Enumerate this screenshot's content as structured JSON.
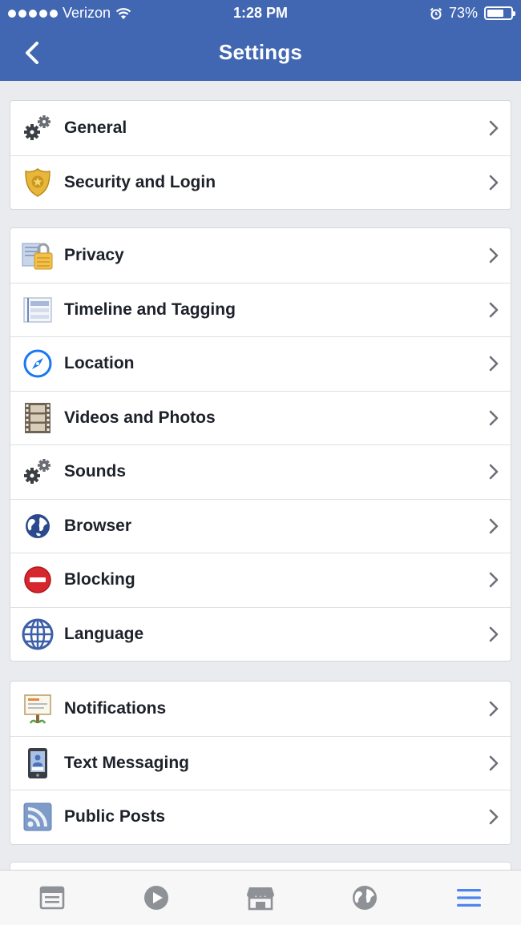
{
  "status_bar": {
    "carrier": "Verizon",
    "time": "1:28 PM",
    "battery": "73%",
    "battery_level": 0.73
  },
  "header": {
    "title": "Settings",
    "back_icon": "chevron-left-icon"
  },
  "groups": [
    {
      "items": [
        {
          "label": "General",
          "icon": "gears-icon"
        },
        {
          "label": "Security and Login",
          "icon": "shield-badge-icon"
        }
      ]
    },
    {
      "items": [
        {
          "label": "Privacy",
          "icon": "privacy-lock-icon"
        },
        {
          "label": "Timeline and Tagging",
          "icon": "timeline-icon"
        },
        {
          "label": "Location",
          "icon": "compass-icon"
        },
        {
          "label": "Videos and Photos",
          "icon": "film-strip-icon"
        },
        {
          "label": "Sounds",
          "icon": "gears-icon"
        },
        {
          "label": "Browser",
          "icon": "globe-icon"
        },
        {
          "label": "Blocking",
          "icon": "block-icon"
        },
        {
          "label": "Language",
          "icon": "world-grid-icon"
        }
      ]
    },
    {
      "items": [
        {
          "label": "Notifications",
          "icon": "notification-sign-icon"
        },
        {
          "label": "Text Messaging",
          "icon": "phone-icon"
        },
        {
          "label": "Public Posts",
          "icon": "rss-icon"
        }
      ]
    }
  ],
  "tabs": [
    {
      "name": "news-feed",
      "icon": "news-feed-icon",
      "active": false
    },
    {
      "name": "video",
      "icon": "video-play-icon",
      "active": false
    },
    {
      "name": "marketplace",
      "icon": "marketplace-icon",
      "active": false
    },
    {
      "name": "notifications",
      "icon": "globe-icon",
      "active": false
    },
    {
      "name": "menu",
      "icon": "menu-icon",
      "active": true
    }
  ],
  "colors": {
    "brand": "#4267b2",
    "active_tab": "#4c84f0",
    "inactive_tab": "#8e9196"
  }
}
